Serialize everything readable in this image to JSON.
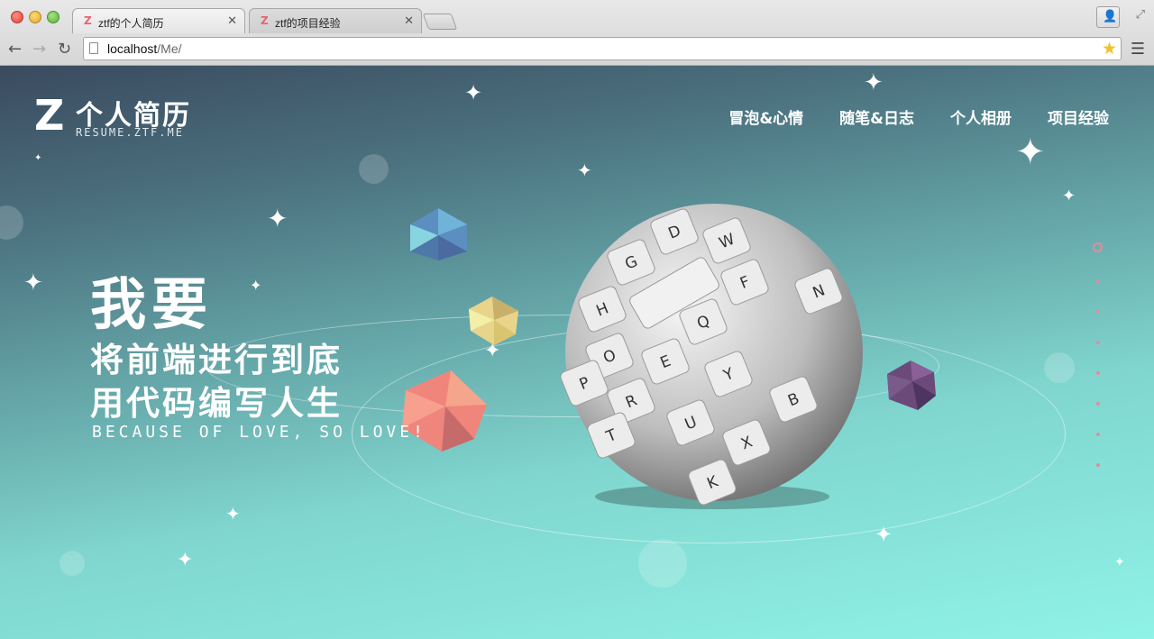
{
  "browser": {
    "tabs": [
      {
        "title": "ztf的个人简历",
        "favicon": "Z",
        "active": true
      },
      {
        "title": "ztf的项目经验",
        "favicon": "Z",
        "active": false
      }
    ],
    "close_glyph": "✕",
    "address": {
      "host": "localhost",
      "path": "/Me/"
    },
    "icons": [
      "back-icon",
      "forward-icon",
      "reload-icon",
      "page-icon",
      "bookmark-star-icon",
      "menu-icon",
      "profile-icon",
      "fullscreen-icon"
    ]
  },
  "site": {
    "logo": {
      "mark": "Z",
      "name": "个人简历",
      "subtitle": "RESUME.ZTF.ME"
    },
    "nav": [
      "冒泡&心情",
      "随笔&日志",
      "个人相册",
      "项目经验"
    ],
    "hero": {
      "line1": "我要",
      "line2": "将前端进行到底",
      "line3": "用代码编写人生",
      "tagline": "BECAUSE OF LOVE, SO LOVE!"
    },
    "keyboard_keys": [
      "D",
      "W",
      "G",
      "F",
      "H",
      "Q",
      "N",
      "O",
      "E",
      "Y",
      "P",
      "R",
      "U",
      "B",
      "T",
      "X",
      "K"
    ],
    "colors": {
      "accent_pink": "#e88a9a",
      "bg_top": "#3a4a5f",
      "bg_bottom": "#8ff3e6"
    }
  }
}
